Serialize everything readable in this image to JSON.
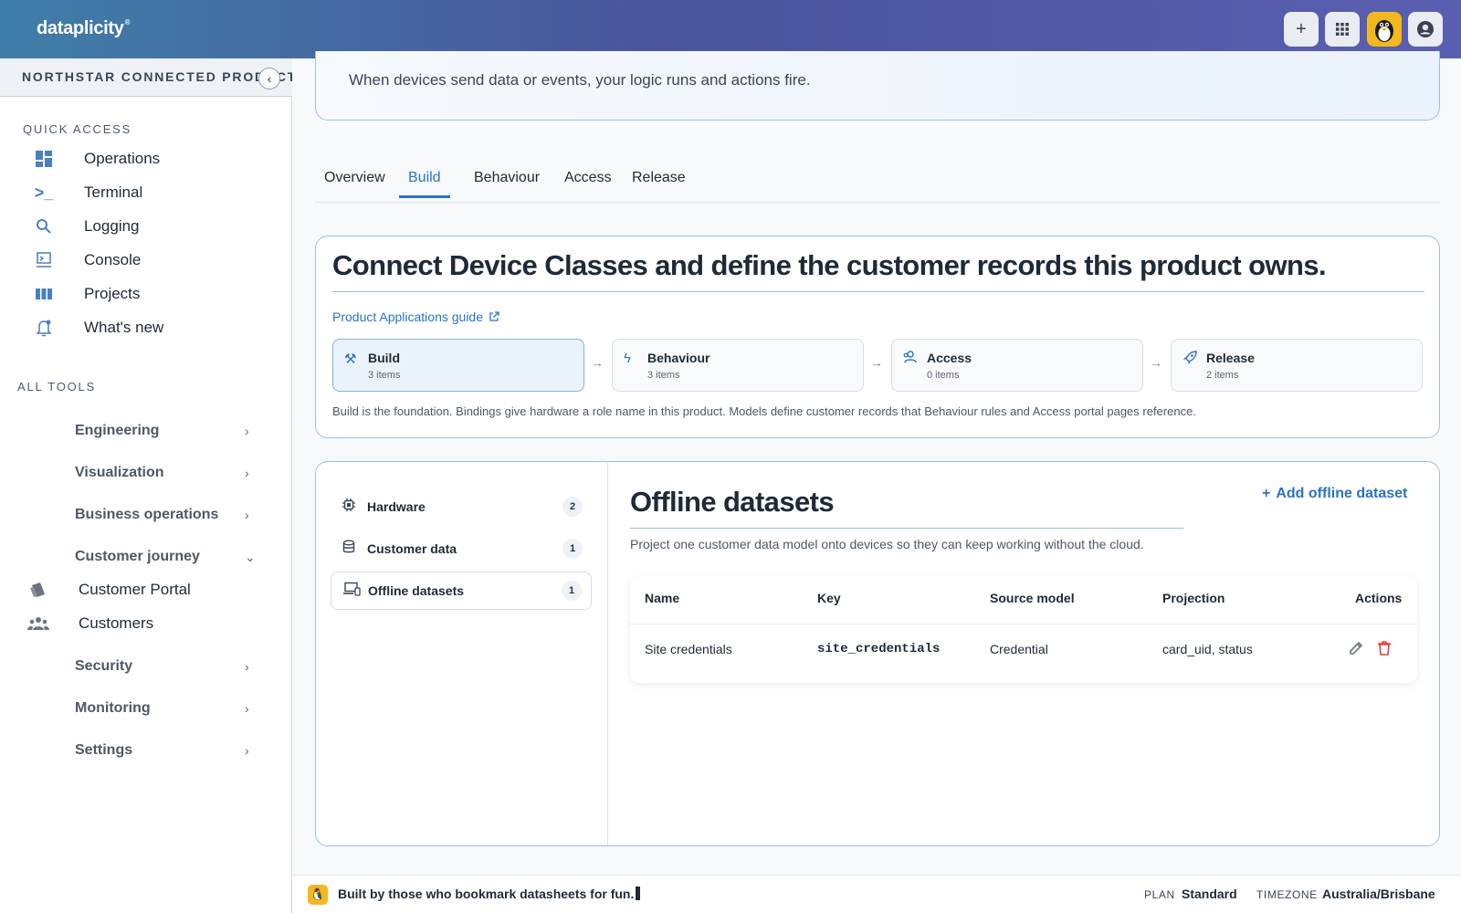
{
  "app": {
    "brand": "dataplicity",
    "brand_mark": "®"
  },
  "topbar": {
    "add_icon": "plus-icon",
    "apps_icon": "grid-icon",
    "avatar_icon": "penguin-icon",
    "account_icon": "account-circle-icon"
  },
  "sidebar": {
    "org_name": "NORTHSTAR CONNECTED PRODUCT",
    "quick_access_label": "QUICK ACCESS",
    "quick_access": [
      {
        "label": "Operations",
        "icon": "dashboard-icon"
      },
      {
        "label": "Terminal",
        "icon": "terminal-icon"
      },
      {
        "label": "Logging",
        "icon": "search-icon"
      },
      {
        "label": "Console",
        "icon": "console-icon"
      },
      {
        "label": "Projects",
        "icon": "columns-icon"
      },
      {
        "label": "What's new",
        "icon": "bell-icon"
      }
    ],
    "all_tools_label": "ALL TOOLS",
    "tools": [
      {
        "label": "Engineering"
      },
      {
        "label": "Visualization"
      },
      {
        "label": "Business operations"
      },
      {
        "label": "Customer journey"
      }
    ],
    "customer_journey_items": [
      {
        "label": "Customer Portal",
        "icon": "portal-icon"
      },
      {
        "label": "Customers",
        "icon": "people-icon"
      }
    ],
    "tools_after": [
      {
        "label": "Security"
      },
      {
        "label": "Monitoring"
      },
      {
        "label": "Settings"
      }
    ]
  },
  "hero": {
    "subtitle": "When devices send data or events, your logic runs and actions fire."
  },
  "tabs": [
    "Overview",
    "Build",
    "Behaviour",
    "Access",
    "Release"
  ],
  "active_tab": "Build",
  "build": {
    "title": "Connect Device Classes and define the customer records this product owns.",
    "guide_link": "Product Applications guide",
    "steps": [
      {
        "title": "Build",
        "count": "3 items",
        "icon": "tools-icon"
      },
      {
        "title": "Behaviour",
        "count": "3 items",
        "icon": "lightning-icon"
      },
      {
        "title": "Access",
        "count": "0 items",
        "icon": "user-access-icon"
      },
      {
        "title": "Release",
        "count": "2 items",
        "icon": "rocket-icon"
      }
    ],
    "description": "Build is the foundation. Bindings give hardware a role name in this product. Models define customer records that Behaviour rules and Access portal pages reference."
  },
  "datasets": {
    "nav": [
      {
        "label": "Hardware",
        "count": "2",
        "icon": "chip-icon"
      },
      {
        "label": "Customer data",
        "count": "1",
        "icon": "database-icon"
      },
      {
        "label": "Offline datasets",
        "count": "1",
        "icon": "offline-devices-icon"
      }
    ],
    "title": "Offline datasets",
    "add_label": "Add offline dataset",
    "description": "Project one customer data model onto devices so they can keep working without the cloud.",
    "columns": [
      "Name",
      "Key",
      "Source model",
      "Projection",
      "Actions"
    ],
    "rows": [
      {
        "name": "Site credentials",
        "key": "site_credentials",
        "source": "Credential",
        "projection": "card_uid, status"
      }
    ]
  },
  "footer": {
    "tagline": "Built by those who bookmark datasheets for fun.",
    "plan_label": "PLAN",
    "plan_value": "Standard",
    "tz_label": "TIMEZONE",
    "tz_value": "Australia/Brisbane"
  },
  "colors": {
    "accent": "#2a73c4",
    "danger": "#e53e3e",
    "header_gradient_start": "#3f7ea8",
    "header_gradient_end": "#5a5eb0"
  }
}
